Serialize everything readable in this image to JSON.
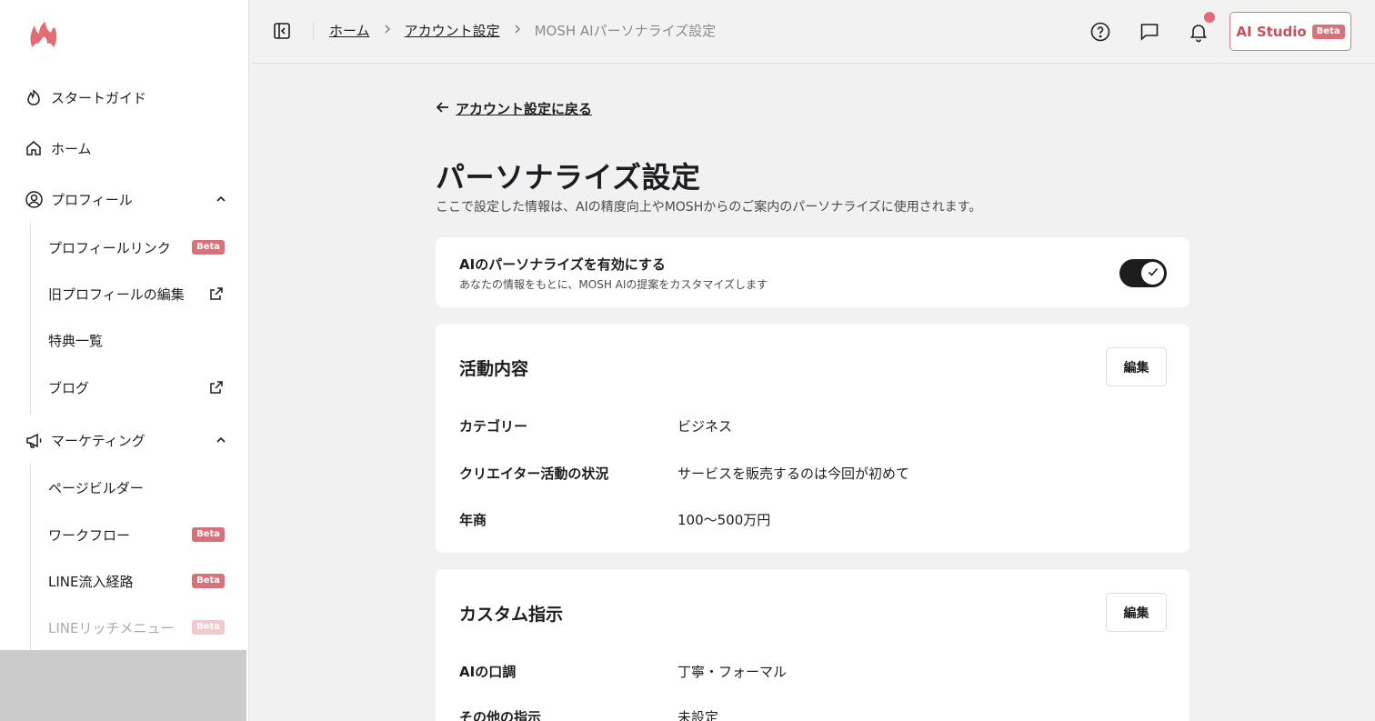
{
  "sidebar": {
    "items": [
      {
        "label": "スタートガイド"
      },
      {
        "label": "ホーム"
      },
      {
        "label": "プロフィール"
      }
    ],
    "profile_sub": [
      {
        "label": "プロフィールリンク",
        "badge": "Beta"
      },
      {
        "label": "旧プロフィールの編集"
      },
      {
        "label": "特典一覧"
      },
      {
        "label": "ブログ"
      }
    ],
    "marketing": {
      "label": "マーケティング"
    },
    "marketing_sub": [
      {
        "label": "ページビルダー"
      },
      {
        "label": "ワークフロー",
        "badge": "Beta"
      },
      {
        "label": "LINE流入経路",
        "badge": "Beta"
      },
      {
        "label": "LINEリッチメニュー",
        "badge": "Beta"
      }
    ]
  },
  "header": {
    "breadcrumb": [
      "ホーム",
      "アカウント設定",
      "MOSH AIパーソナライズ設定"
    ],
    "ai_studio": "AI Studio",
    "ai_studio_badge": "Beta"
  },
  "main": {
    "back_link": "アカウント設定に戻る",
    "title": "パーソナライズ設定",
    "description": "ここで設定した情報は、AIの精度向上やMOSHからのご案内のパーソナライズに使用されます。",
    "toggle_card": {
      "title": "AIのパーソナライズを有効にする",
      "subtitle": "あなたの情報をもとに、MOSH AIの提案をカスタマイズします",
      "enabled": true
    },
    "activity": {
      "title": "活動内容",
      "edit": "編集",
      "rows": [
        {
          "label": "カテゴリー",
          "value": "ビジネス"
        },
        {
          "label": "クリエイター活動の状況",
          "value": "サービスを販売するのは今回が初めて"
        },
        {
          "label": "年商",
          "value": "100〜500万円"
        }
      ]
    },
    "custom": {
      "title": "カスタム指示",
      "edit": "編集",
      "rows": [
        {
          "label": "AIの口調",
          "value": "丁寧・フォーマル"
        },
        {
          "label": "その他の指示",
          "value": "未設定"
        }
      ]
    }
  },
  "colors": {
    "accent": "#d7727b",
    "brand_text": "#c8505a",
    "dark": "#1d1d1f"
  }
}
